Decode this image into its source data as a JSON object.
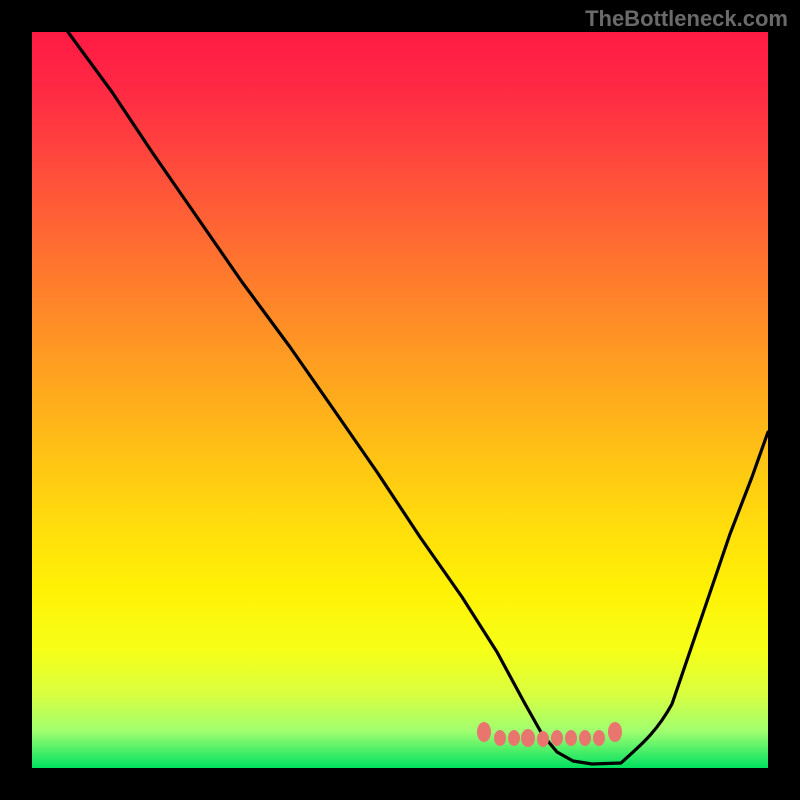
{
  "watermark": "TheBottleneck.com",
  "chart_data": {
    "type": "line",
    "title": "",
    "xlabel": "",
    "ylabel": "",
    "x_range": [
      0,
      100
    ],
    "y_range": [
      0,
      100
    ],
    "series": [
      {
        "name": "bottleneck-curve",
        "x": [
          5,
          10,
          15,
          20,
          25,
          30,
          35,
          40,
          45,
          50,
          55,
          60,
          62,
          65,
          68,
          70,
          74,
          78,
          82,
          86,
          90,
          95,
          100
        ],
        "y": [
          100,
          92,
          83,
          75,
          66,
          58,
          49,
          41,
          32,
          24,
          15,
          7,
          4,
          2,
          1,
          1,
          1,
          2,
          5,
          13,
          23,
          36,
          50
        ],
        "color": "#000000"
      },
      {
        "name": "bottleneck-markers",
        "x": [
          60,
          62,
          64,
          66,
          68,
          70,
          72,
          74,
          76,
          78
        ],
        "y": [
          5,
          4.2,
          4.2,
          4.2,
          4,
          4.2,
          4.2,
          4.2,
          4.2,
          5
        ],
        "color": "#e8766f"
      }
    ],
    "gradient_stops": [
      {
        "offset": 0,
        "color": "#ff1a44"
      },
      {
        "offset": 18,
        "color": "#ff4a3c"
      },
      {
        "offset": 42,
        "color": "#ff9524"
      },
      {
        "offset": 65,
        "color": "#ffd80e"
      },
      {
        "offset": 84,
        "color": "#f6ff18"
      },
      {
        "offset": 100,
        "color": "#00e060"
      }
    ]
  }
}
